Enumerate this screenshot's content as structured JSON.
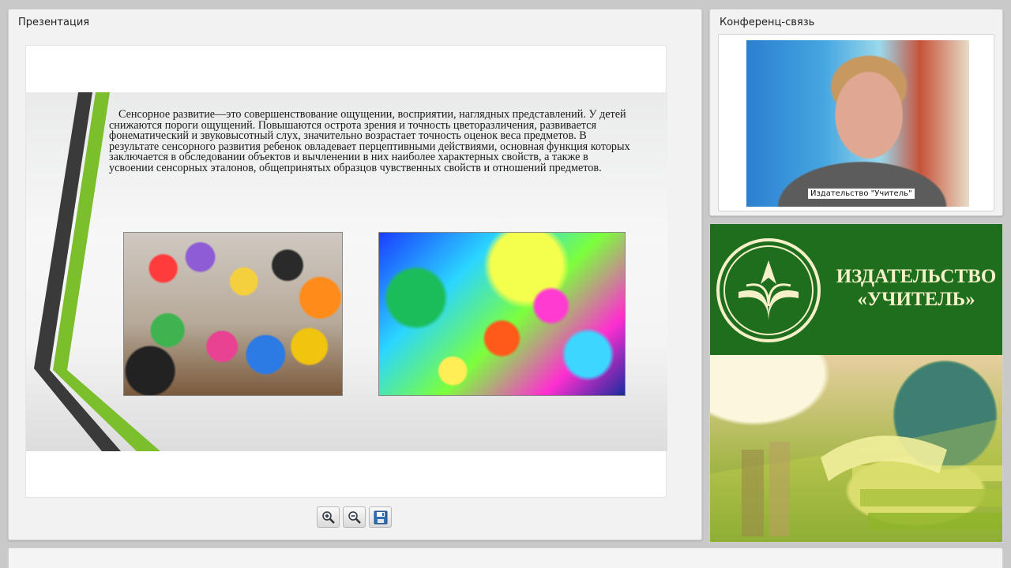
{
  "presentation": {
    "title": "Презентация",
    "slide": {
      "text": "Сенсорное развитие—это совершенствование ощущении, восприятии, наглядных представлений. У детей снижаются пороги ощущений. Повышаются острота зрения и точность цветоразличения, развивается фонематический и звуковысотный слух, значительно возрастает точность оценок веса предметов. В результате сенсорного развития ребенок овладевает перцептивными действиями, основная функция которых заключается в обследовании объектов и вычленении в них наиболее характерных свойств, а также в усвоении сенсорных эталонов, общепринятых образцов чувственных свойств и отношений предметов.",
      "accent_colors": {
        "green": "#7cbf2c",
        "dark": "#3a3a3a"
      }
    },
    "toolbar": {
      "zoom_in_icon": "zoom-in-icon",
      "zoom_out_icon": "zoom-out-icon",
      "save_icon": "floppy-disk-icon"
    }
  },
  "conference": {
    "title": "Конференц-связь",
    "video_caption": "Издательство \"Учитель\""
  },
  "publisher": {
    "line1": "ИЗДАТЕЛЬСТВО",
    "line2": "«УЧИТЕЛЬ»",
    "colors": {
      "green": "#1e6e1e",
      "cream": "#f5f0c8"
    }
  }
}
